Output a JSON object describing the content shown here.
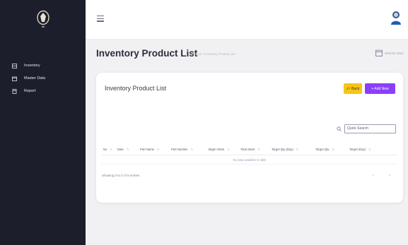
{
  "sidebar": {
    "logo": "shield-logo",
    "items": [
      {
        "label": "Inventory",
        "icon": "grid-icon"
      },
      {
        "label": "Master Data",
        "icon": "folder-icon"
      },
      {
        "label": "Report",
        "icon": "document-icon"
      }
    ]
  },
  "topbar": {
    "menu_icon": "hamburger-icon",
    "avatar_icon": "user-avatar"
  },
  "header": {
    "title": "Inventory Product List",
    "breadcrumb": "Prototype / Inventory Product List",
    "date": "Wed 01 2021"
  },
  "card": {
    "title": "Inventory Product List",
    "back_label": "Back",
    "add_label": "+ Add New",
    "search_placeholder": "Quick Search",
    "columns": [
      "No",
      "Date",
      "Part Name",
      "Part Number",
      "Begin Stock",
      "Total Stock",
      "Target Qty (Day)",
      "Target Qty",
      "Target (Day)"
    ],
    "empty_message": "No data available in table",
    "showing_text": "Showing 0 to 0 of 0 entries",
    "prev_label": "‹",
    "next_label": "›"
  },
  "colors": {
    "sidebar_bg": "#1d1e2c",
    "back_button": "#f5c518",
    "add_button": "#8c3ffb",
    "avatar": "#1e5fb3"
  }
}
